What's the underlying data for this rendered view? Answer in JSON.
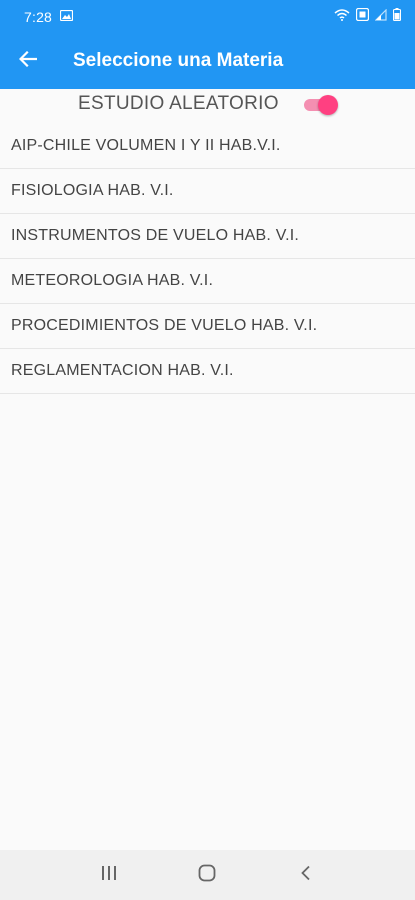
{
  "status": {
    "time": "7:28"
  },
  "app_bar": {
    "title": "Seleccione una Materia"
  },
  "random": {
    "label": "ESTUDIO ALEATORIO",
    "enabled": true
  },
  "subjects": [
    {
      "label": "AIP-CHILE VOLUMEN I Y II HAB.V.I."
    },
    {
      "label": "FISIOLOGIA HAB. V.I."
    },
    {
      "label": "INSTRUMENTOS DE VUELO HAB. V.I."
    },
    {
      "label": "METEOROLOGIA HAB. V.I."
    },
    {
      "label": "PROCEDIMIENTOS DE VUELO HAB. V.I."
    },
    {
      "label": "REGLAMENTACION HAB. V.I."
    }
  ],
  "colors": {
    "primary": "#2196f3",
    "accent": "#ff4081"
  },
  "icons": {
    "status_left": [
      "image-icon"
    ],
    "status_right": [
      "wifi-icon",
      "data-saver-icon",
      "signal-icon",
      "battery-icon"
    ],
    "nav": [
      "recents-icon",
      "home-icon",
      "back-nav-icon"
    ]
  }
}
